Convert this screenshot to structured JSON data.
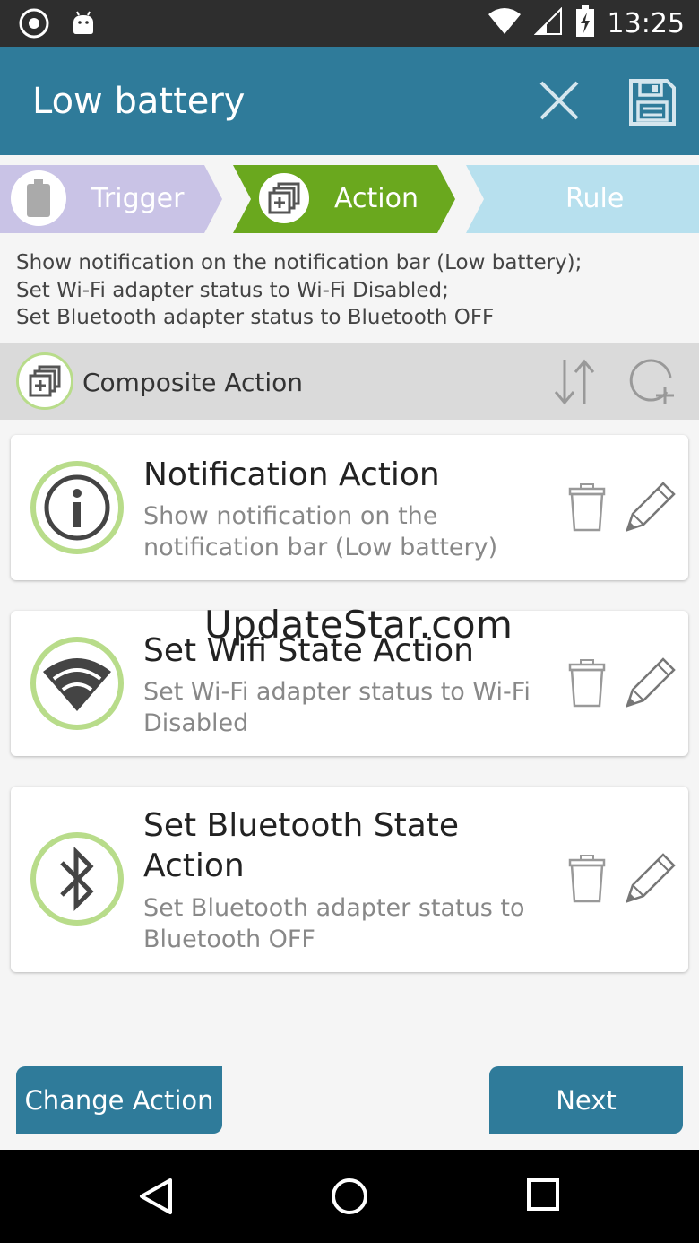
{
  "status_bar": {
    "time": "13:25",
    "left_icons": [
      "target-icon",
      "android-icon"
    ],
    "right_icons": [
      "wifi-icon",
      "signal-icon",
      "battery-charging-icon"
    ]
  },
  "app_bar": {
    "title": "Low battery",
    "close_icon": "close-icon",
    "save_icon": "save-icon"
  },
  "steps": [
    {
      "label": "Trigger",
      "icon": "battery-icon",
      "state": "done",
      "color": "#c9c3e6"
    },
    {
      "label": "Action",
      "icon": "composite-action-icon",
      "state": "active",
      "color": "#6aa81e"
    },
    {
      "label": "Rule",
      "icon": "",
      "state": "pending",
      "color": "#b7e0ee"
    }
  ],
  "summary": [
    "Show notification on the notification bar (Low battery);",
    "Set Wi-Fi adapter status to Wi-Fi Disabled;",
    "Set Bluetooth adapter status to Bluetooth OFF"
  ],
  "composite": {
    "label": "Composite Action",
    "icon": "composite-action-icon",
    "sort_icon": "sort-icon",
    "add_icon": "add-circle-icon"
  },
  "actions": [
    {
      "title": "Notification Action",
      "description": "Show notification on the notification bar (Low battery)",
      "icon": "info-icon"
    },
    {
      "title": "Set Wifi State Action",
      "description": "Set Wi-Fi adapter status to Wi-Fi Disabled",
      "icon": "wifi-icon"
    },
    {
      "title": "Set Bluetooth State Action",
      "description": "Set Bluetooth adapter status to Bluetooth OFF",
      "icon": "bluetooth-icon"
    }
  ],
  "watermark": "UpdateStar.com",
  "buttons": {
    "change_action": "Change Action",
    "next": "Next"
  },
  "colors": {
    "primary": "#2f7b9a",
    "accent_green": "#6aa81e",
    "ring_green": "#b8dc8a"
  }
}
